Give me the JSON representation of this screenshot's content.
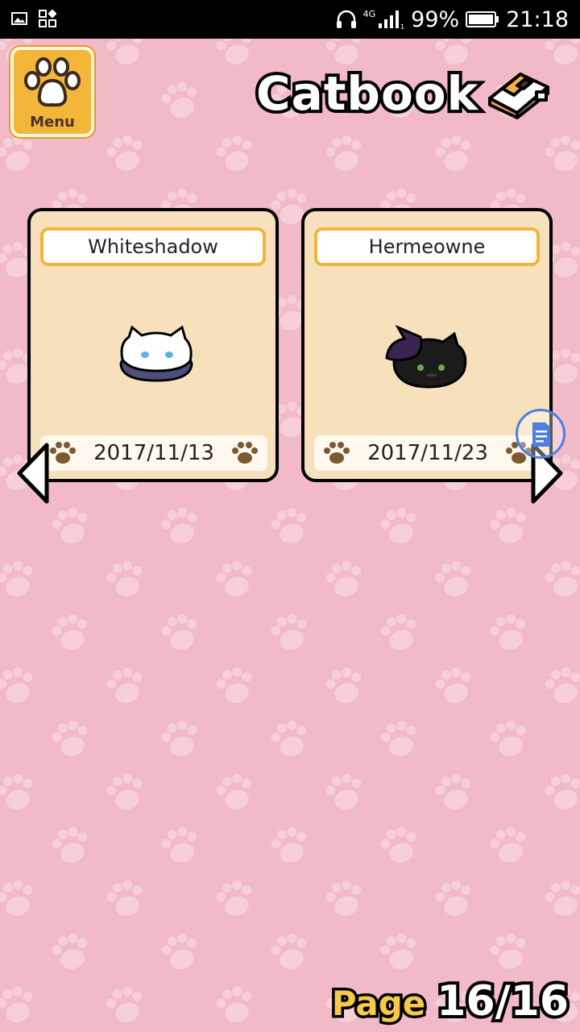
{
  "status_bar": {
    "network_label": "4G",
    "battery_percent": "99%",
    "time": "21:18",
    "icons": [
      "image-icon",
      "grid-icon",
      "headphones-icon",
      "signal-icon",
      "battery-icon"
    ]
  },
  "header": {
    "menu_label": "Menu",
    "title": "Catbook"
  },
  "cards": [
    {
      "name": "Whiteshadow",
      "date": "2017/11/13",
      "cat": "white-cat-lying-icon"
    },
    {
      "name": "Hermeowne",
      "date": "2017/11/23",
      "cat": "black-cat-witch-hat-icon"
    }
  ],
  "pagination": {
    "label": "Page",
    "value": "16/16"
  },
  "colors": {
    "background": "#f2b9c6",
    "card": "#f7e1bd",
    "accent": "#f3b53a",
    "paw": "#7a5a2e"
  }
}
